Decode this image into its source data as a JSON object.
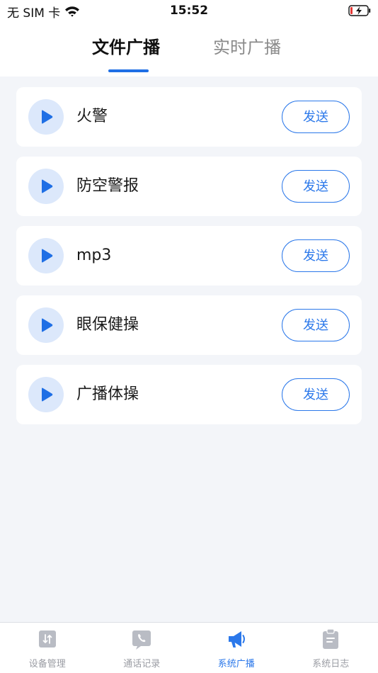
{
  "status_bar": {
    "carrier": "无 SIM 卡",
    "time": "15:52"
  },
  "header": {
    "tabs": [
      {
        "label": "文件广播",
        "active": true
      },
      {
        "label": "实时广播",
        "active": false
      }
    ]
  },
  "files": [
    {
      "name": "火警",
      "send_label": "发送"
    },
    {
      "name": "防空警报",
      "send_label": "发送"
    },
    {
      "name": "mp3",
      "send_label": "发送"
    },
    {
      "name": "眼保健操",
      "send_label": "发送"
    },
    {
      "name": "广播体操",
      "send_label": "发送"
    }
  ],
  "bottom_nav": [
    {
      "label": "设备管理",
      "icon": "device-manage-icon",
      "active": false
    },
    {
      "label": "通话记录",
      "icon": "phone-icon",
      "active": false
    },
    {
      "label": "系统广播",
      "icon": "megaphone-icon",
      "active": true
    },
    {
      "label": "系统日志",
      "icon": "clipboard-icon",
      "active": false
    }
  ],
  "colors": {
    "accent": "#2b78ea",
    "play_bg": "#dce8fb",
    "page_bg": "#f3f5f9",
    "inactive": "#9a9ca3"
  }
}
